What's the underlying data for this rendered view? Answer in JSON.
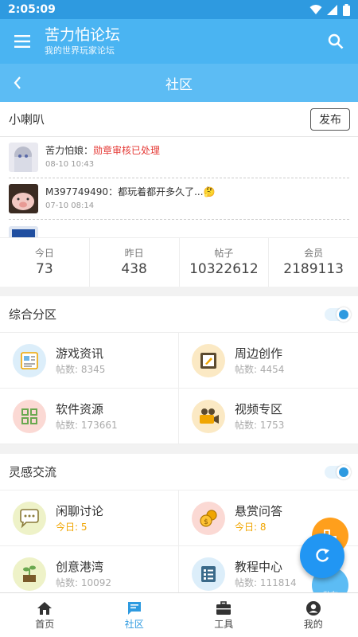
{
  "status": {
    "time": "2:05:09"
  },
  "app": {
    "title": "苦力怕论坛",
    "subtitle": "我的世界玩家论坛"
  },
  "page": {
    "title": "社区"
  },
  "notice": {
    "title": "小喇叭",
    "publish_label": "发布",
    "messages": [
      {
        "user": "苦力怕娘：",
        "text": "勋章审核已处理",
        "time": "08-10 10:43",
        "highlight": true
      },
      {
        "user": "M397749490：",
        "text": "都玩着都开多久了...🤔",
        "time": "07-10 08:14",
        "highlight": false
      },
      {
        "user": "",
        "text": "",
        "time": "",
        "highlight": false
      }
    ]
  },
  "stats": [
    {
      "label": "今日",
      "value": "73"
    },
    {
      "label": "昨日",
      "value": "438"
    },
    {
      "label": "帖子",
      "value": "10322612"
    },
    {
      "label": "会员",
      "value": "2189113"
    }
  ],
  "sections": [
    {
      "title": "综合分区",
      "items": [
        {
          "name": "游戏资讯",
          "sub": "帖数: 8345",
          "icon": "newspaper-icon",
          "color": "#dceefa",
          "today": false
        },
        {
          "name": "周边创作",
          "sub": "帖数: 4454",
          "icon": "frame-icon",
          "color": "#fbe9c4",
          "today": false
        },
        {
          "name": "软件资源",
          "sub": "帖数: 173661",
          "icon": "grid-icon",
          "color": "#fbd9d4",
          "today": false
        },
        {
          "name": "视频专区",
          "sub": "帖数: 1753",
          "icon": "camera-icon",
          "color": "#fbe9c4",
          "today": false
        }
      ]
    },
    {
      "title": "灵感交流",
      "items": [
        {
          "name": "闲聊讨论",
          "sub": "今日: 5",
          "icon": "chat-icon",
          "color": "#eef2c8",
          "today": true
        },
        {
          "name": "悬赏问答",
          "sub": "今日: 8",
          "icon": "coins-icon",
          "color": "#fbd9d4",
          "today": true
        },
        {
          "name": "创意港湾",
          "sub": "帖数: 10092",
          "icon": "sprout-icon",
          "color": "#eef2c8",
          "today": false
        },
        {
          "name": "教程中心",
          "sub": "帖数: 111814",
          "icon": "list-icon",
          "color": "#dceefa",
          "today": false
        }
      ]
    }
  ],
  "fab": {
    "secondary_label": "发布"
  },
  "nav": [
    {
      "label": "首页",
      "icon": "home-icon",
      "active": false
    },
    {
      "label": "社区",
      "icon": "community-icon",
      "active": true
    },
    {
      "label": "工具",
      "icon": "toolbox-icon",
      "active": false
    },
    {
      "label": "我的",
      "icon": "profile-icon",
      "active": false
    }
  ],
  "colors": {
    "primary": "#4ab4f2",
    "accent": "#2196f3",
    "today": "#f0a500",
    "alert": "#e53935"
  }
}
